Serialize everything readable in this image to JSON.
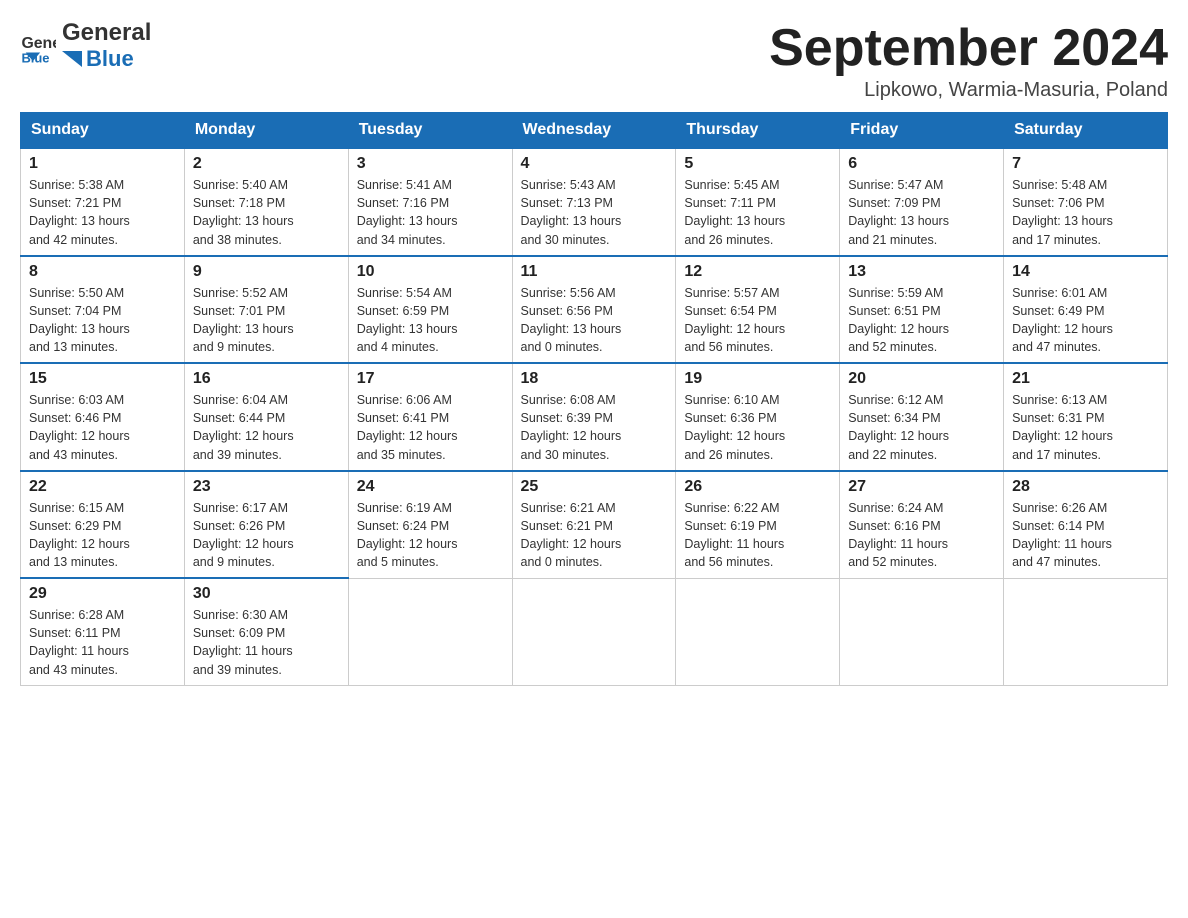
{
  "header": {
    "logo_general": "General",
    "logo_blue": "Blue",
    "month_title": "September 2024",
    "location": "Lipkowo, Warmia-Masuria, Poland"
  },
  "days_of_week": [
    "Sunday",
    "Monday",
    "Tuesday",
    "Wednesday",
    "Thursday",
    "Friday",
    "Saturday"
  ],
  "weeks": [
    [
      {
        "day": "1",
        "sunrise": "5:38 AM",
        "sunset": "7:21 PM",
        "daylight": "13 hours and 42 minutes."
      },
      {
        "day": "2",
        "sunrise": "5:40 AM",
        "sunset": "7:18 PM",
        "daylight": "13 hours and 38 minutes."
      },
      {
        "day": "3",
        "sunrise": "5:41 AM",
        "sunset": "7:16 PM",
        "daylight": "13 hours and 34 minutes."
      },
      {
        "day": "4",
        "sunrise": "5:43 AM",
        "sunset": "7:13 PM",
        "daylight": "13 hours and 30 minutes."
      },
      {
        "day": "5",
        "sunrise": "5:45 AM",
        "sunset": "7:11 PM",
        "daylight": "13 hours and 26 minutes."
      },
      {
        "day": "6",
        "sunrise": "5:47 AM",
        "sunset": "7:09 PM",
        "daylight": "13 hours and 21 minutes."
      },
      {
        "day": "7",
        "sunrise": "5:48 AM",
        "sunset": "7:06 PM",
        "daylight": "13 hours and 17 minutes."
      }
    ],
    [
      {
        "day": "8",
        "sunrise": "5:50 AM",
        "sunset": "7:04 PM",
        "daylight": "13 hours and 13 minutes."
      },
      {
        "day": "9",
        "sunrise": "5:52 AM",
        "sunset": "7:01 PM",
        "daylight": "13 hours and 9 minutes."
      },
      {
        "day": "10",
        "sunrise": "5:54 AM",
        "sunset": "6:59 PM",
        "daylight": "13 hours and 4 minutes."
      },
      {
        "day": "11",
        "sunrise": "5:56 AM",
        "sunset": "6:56 PM",
        "daylight": "13 hours and 0 minutes."
      },
      {
        "day": "12",
        "sunrise": "5:57 AM",
        "sunset": "6:54 PM",
        "daylight": "12 hours and 56 minutes."
      },
      {
        "day": "13",
        "sunrise": "5:59 AM",
        "sunset": "6:51 PM",
        "daylight": "12 hours and 52 minutes."
      },
      {
        "day": "14",
        "sunrise": "6:01 AM",
        "sunset": "6:49 PM",
        "daylight": "12 hours and 47 minutes."
      }
    ],
    [
      {
        "day": "15",
        "sunrise": "6:03 AM",
        "sunset": "6:46 PM",
        "daylight": "12 hours and 43 minutes."
      },
      {
        "day": "16",
        "sunrise": "6:04 AM",
        "sunset": "6:44 PM",
        "daylight": "12 hours and 39 minutes."
      },
      {
        "day": "17",
        "sunrise": "6:06 AM",
        "sunset": "6:41 PM",
        "daylight": "12 hours and 35 minutes."
      },
      {
        "day": "18",
        "sunrise": "6:08 AM",
        "sunset": "6:39 PM",
        "daylight": "12 hours and 30 minutes."
      },
      {
        "day": "19",
        "sunrise": "6:10 AM",
        "sunset": "6:36 PM",
        "daylight": "12 hours and 26 minutes."
      },
      {
        "day": "20",
        "sunrise": "6:12 AM",
        "sunset": "6:34 PM",
        "daylight": "12 hours and 22 minutes."
      },
      {
        "day": "21",
        "sunrise": "6:13 AM",
        "sunset": "6:31 PM",
        "daylight": "12 hours and 17 minutes."
      }
    ],
    [
      {
        "day": "22",
        "sunrise": "6:15 AM",
        "sunset": "6:29 PM",
        "daylight": "12 hours and 13 minutes."
      },
      {
        "day": "23",
        "sunrise": "6:17 AM",
        "sunset": "6:26 PM",
        "daylight": "12 hours and 9 minutes."
      },
      {
        "day": "24",
        "sunrise": "6:19 AM",
        "sunset": "6:24 PM",
        "daylight": "12 hours and 5 minutes."
      },
      {
        "day": "25",
        "sunrise": "6:21 AM",
        "sunset": "6:21 PM",
        "daylight": "12 hours and 0 minutes."
      },
      {
        "day": "26",
        "sunrise": "6:22 AM",
        "sunset": "6:19 PM",
        "daylight": "11 hours and 56 minutes."
      },
      {
        "day": "27",
        "sunrise": "6:24 AM",
        "sunset": "6:16 PM",
        "daylight": "11 hours and 52 minutes."
      },
      {
        "day": "28",
        "sunrise": "6:26 AM",
        "sunset": "6:14 PM",
        "daylight": "11 hours and 47 minutes."
      }
    ],
    [
      {
        "day": "29",
        "sunrise": "6:28 AM",
        "sunset": "6:11 PM",
        "daylight": "11 hours and 43 minutes."
      },
      {
        "day": "30",
        "sunrise": "6:30 AM",
        "sunset": "6:09 PM",
        "daylight": "11 hours and 39 minutes."
      },
      null,
      null,
      null,
      null,
      null
    ]
  ],
  "labels": {
    "sunrise": "Sunrise:",
    "sunset": "Sunset:",
    "daylight": "Daylight:"
  }
}
